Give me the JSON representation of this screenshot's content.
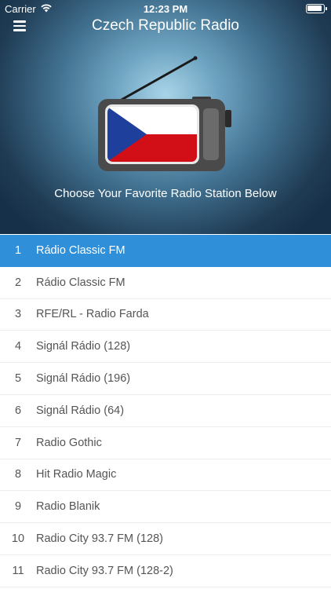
{
  "status": {
    "carrier": "Carrier",
    "time": "12:23 PM"
  },
  "header": {
    "title": "Czech Republic Radio",
    "subtitle": "Choose Your Favorite Radio Station Below"
  },
  "colors": {
    "accent": "#2f8fd9",
    "flag_blue": "#1f3f9c",
    "flag_red": "#d20f17"
  },
  "icons": {
    "menu": "hamburger-menu-icon",
    "radio": "radio-flag-icon"
  },
  "stations": [
    {
      "num": "1",
      "name": "Rádio Classic FM",
      "selected": true
    },
    {
      "num": "2",
      "name": "Rádio Classic FM"
    },
    {
      "num": "3",
      "name": "RFE/RL - Radio Farda"
    },
    {
      "num": "4",
      "name": "Signál Rádio (128)"
    },
    {
      "num": "5",
      "name": "Signál Rádio (196)"
    },
    {
      "num": "6",
      "name": "Signál Rádio (64)"
    },
    {
      "num": "7",
      "name": "Radio Gothic"
    },
    {
      "num": "8",
      "name": "Hit Radio Magic"
    },
    {
      "num": "9",
      "name": "Radio Blanik"
    },
    {
      "num": "10",
      "name": "Radio City 93.7 FM (128)"
    },
    {
      "num": "11",
      "name": "Radio City 93.7 FM (128-2)"
    }
  ]
}
